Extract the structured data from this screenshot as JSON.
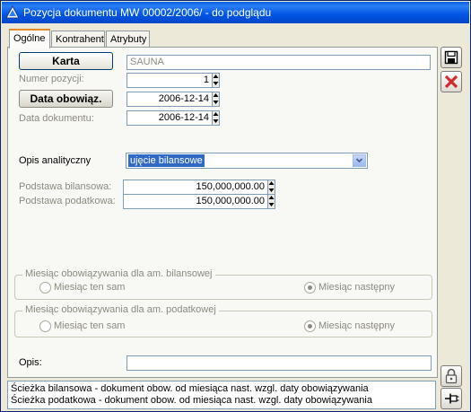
{
  "window": {
    "title": "Pozycja dokumentu MW  00002/2006/ - do podglądu"
  },
  "tabs": [
    {
      "label": "Ogólne",
      "active": true
    },
    {
      "label": "Kontrahent",
      "active": false
    },
    {
      "label": "Atrybuty",
      "active": false
    }
  ],
  "form": {
    "karta_button": "Karta",
    "karta_value": "SAUNA",
    "numer_label": "Numer pozycji:",
    "numer_value": "1",
    "data_obow_button": "Data obowiąz.",
    "data_obow_value": "2006-12-14",
    "data_dok_label": "Data dokumentu:",
    "data_dok_value": "2006-12-14",
    "opis_analityczny_label": "Opis analityczny",
    "opis_analityczny_value": "ujęcie bilansowe",
    "podstawa_bil_label": "Podstawa bilansowa:",
    "podstawa_bil_value": "150,000,000.00",
    "podstawa_pod_label": "Podstawa podatkowa:",
    "podstawa_pod_value": "150,000,000.00",
    "opis_label": "Opis:",
    "opis_value": ""
  },
  "group_bil": {
    "title": "Miesiąc obowiązywania dla am. bilansowej",
    "opt1": "Miesiąc ten sam",
    "opt2": "Miesiąc następny",
    "selected": "opt2"
  },
  "group_pod": {
    "title": "Miesiąc obowiązywania dla am. podatkowej",
    "opt1": "Miesiąc ten sam",
    "opt2": "Miesiąc następny",
    "selected": "opt2"
  },
  "status": {
    "line1": "Ścieżka bilansowa - dokument obow. od miesiąca nast. wzgl. daty obowiązywania",
    "line2": "Ścieżka podatkowa - dokument obow. od miesiąca nast. wzgl. daty obowiązywania"
  },
  "side_buttons": [
    "save-icon",
    "close-red-x-icon",
    "lock-icon",
    "pin-icon"
  ],
  "colors": {
    "title_bar": "#0054e3",
    "selection": "#316ac5",
    "close_x": "#d32b2b"
  }
}
